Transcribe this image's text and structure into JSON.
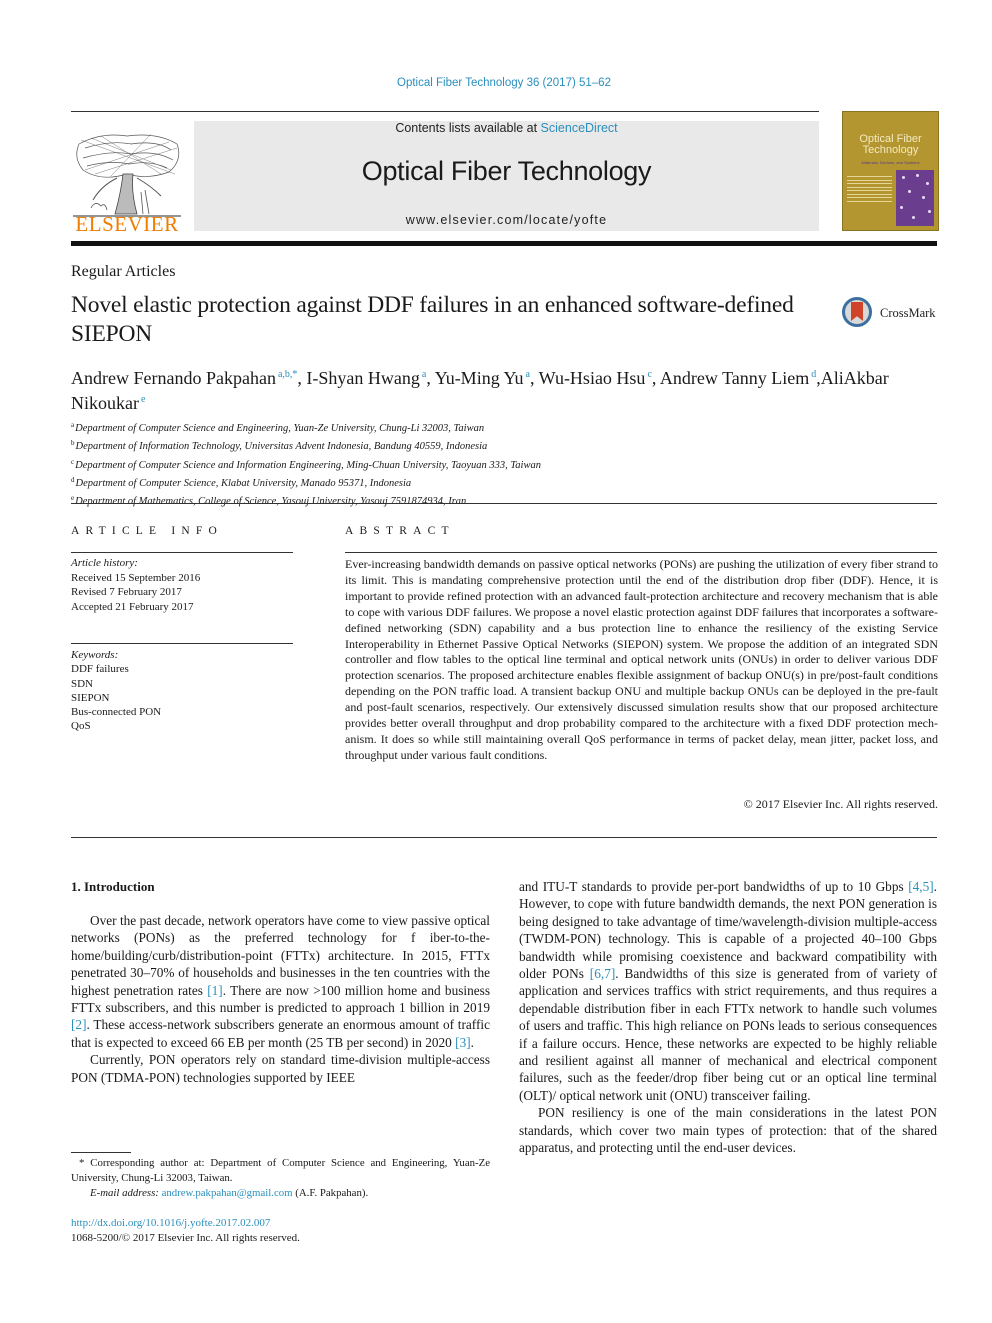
{
  "header": {
    "journal_reference": "Optical Fiber Technology 36 (2017) 51–62",
    "contents_prefix": "Contents lists available at ",
    "contents_link": "ScienceDirect",
    "journal_title": "Optical Fiber Technology",
    "journal_url": "www.elsevier.com/locate/yofte",
    "publisher_wordmark": "ELSEVIER",
    "cover": {
      "title_line1": "Optical Fiber",
      "title_line2": "Technology",
      "subtitle": "Materials, Devices, and Systems"
    },
    "colors": {
      "link": "#2a8fbd",
      "elsevier_orange": "#f07c00",
      "banner_bg": "#e9e9e9"
    }
  },
  "article": {
    "section": "Regular Articles",
    "title": "Novel elastic protection against DDF failures in an enhanced software-defined SIEPON",
    "crossmark_label": "CrossMark",
    "authors": [
      {
        "name": "Andrew Fernando Pakpahan",
        "marks": "a,b,*",
        "sep": ", "
      },
      {
        "name": "I-Shyan Hwang",
        "marks": "a",
        "sep": ", "
      },
      {
        "name": "Yu-Ming Yu",
        "marks": "a",
        "sep": ", "
      },
      {
        "name": "Wu-Hsiao Hsu",
        "marks": "c",
        "sep": ", "
      },
      {
        "name": "Andrew Tanny Liem",
        "marks": "d",
        "sep": ","
      },
      {
        "name": "AliAkbar Nikoukar",
        "marks": "e",
        "sep": ""
      }
    ],
    "affiliations": [
      {
        "key": "a",
        "text": "Department of Computer Science and Engineering, Yuan-Ze University, Chung-Li 32003, Taiwan"
      },
      {
        "key": "b",
        "text": "Department of Information Technology, Universitas Advent Indonesia, Bandung 40559, Indonesia"
      },
      {
        "key": "c",
        "text": "Department of Computer Science and Information Engineering, Ming-Chuan University, Taoyuan 333, Taiwan"
      },
      {
        "key": "d",
        "text": "Department of Computer Science, Klabat University, Manado 95371, Indonesia"
      },
      {
        "key": "e",
        "text": "Department of Mathematics, College of Science, Yasouj University, Yasouj 7591874934, Iran"
      }
    ]
  },
  "article_info": {
    "heading": "ARTICLE INFO",
    "history_label": "Article history:",
    "history": [
      "Received 15 September 2016",
      "Revised 7 February 2017",
      "Accepted 21 February 2017"
    ],
    "keywords_label": "Keywords:",
    "keywords": [
      "DDF failures",
      "SDN",
      "SIEPON",
      "Bus-connected PON",
      "QoS"
    ]
  },
  "abstract": {
    "heading": "ABSTRACT",
    "text": "Ever-increasing bandwidth demands on passive optical networks (PONs) are pushing the utilization of every fiber strand to its limit. This is mandating comprehensive protection until the end of the distribu­tion drop fiber (DDF). Hence, it is important to provide refined protection with an advanced fault-protection architecture and recovery mechanism that is able to cope with various DDF failures. We pro­pose a novel elastic protection against DDF failures that incorporates a software-defined networking (SDN) capability and a bus protection line to enhance the resiliency of the existing Service Interoperability in Ethernet Passive Optical Networks (SIEPON) system. We propose the addition of an integrated SDN controller and flow tables to the optical line terminal and optical network units (ONUs) in order to deliver various DDF protection scenarios. The proposed architecture enables flexible assignment of backup ONU(s) in pre/post-fault conditions depending on the PON traffic load. A transient backup ONU and multiple backup ONUs can be deployed in the pre-fault and post-fault scenarios, respec­tively. Our extensively discussed simulation results show that our proposed architecture provides better overall throughput and drop probability compared to the architecture with a fixed DDF protection mech­anism. It does so while still maintaining overall QoS performance in terms of packet delay, mean jitter, packet loss, and throughput under various fault conditions.",
    "copyright": "© 2017 Elsevier Inc. All rights reserved."
  },
  "body": {
    "section_heading": "1. Introduction",
    "left_paragraphs": [
      [
        {
          "t": "Over the past decade, network operators have come to view passive optical networks (PONs) as the preferred technology for f iber-to-the-home/building/curb/distribution-point (FTTx) archi­tecture. In 2015, FTTx penetrated 30–70% of households and busi­nesses in the ten countries with the highest penetration rates "
        },
        {
          "t": "[1]",
          "link": true
        },
        {
          "t": ". There are now >100 million home and business FTTx subscribers, and this number is predicted to approach 1 billion in 2019 "
        },
        {
          "t": "[2]",
          "link": true
        },
        {
          "t": ". These access-network subscribers generate an enormous amount of traffic that is expected to exceed 66 EB per month (25 TB per second) in 2020 "
        },
        {
          "t": "[3]",
          "link": true
        },
        {
          "t": "."
        }
      ],
      [
        {
          "t": "Currently, PON operators rely on standard time-division multiple-access PON (TDMA-PON) technologies supported by IEEE"
        }
      ]
    ],
    "right_paragraphs": [
      [
        {
          "t": "and ITU-T standards to provide per-port bandwidths of up to 10 Gbps "
        },
        {
          "t": "[4,5]",
          "link": true
        },
        {
          "t": ". However, to cope with future bandwidth demands, the next PON generation is being designed to take advantage of time/wavelength-division multiple-access (TWDM-PON) technol­ogy. This is capable of a projected 40–100 Gbps bandwidth while promising coexistence and backward compatibility with older PONs "
        },
        {
          "t": "[6,7]",
          "link": true
        },
        {
          "t": ". Bandwidths of this size is generated from of variety of application and services traffics with strict requirements, and thus requires a dependable distribution fiber in each FTTx network to handle such volumes of users and traffic. This high reliance on PONs leads to serious consequences if a failure occurs. Hence, these networks are expected to be highly reliable and resilient against all manner of mechanical and electrical component failures, such as the feeder/drop fiber being cut or an optical line terminal (OLT)/ optical network unit (ONU) transceiver failing."
        }
      ],
      [
        {
          "t": "PON resiliency is one of the main considerations in the latest PON standards, which cover two main types of protection: that of the shared apparatus, and protecting until the end-user devices."
        }
      ]
    ]
  },
  "footnotes": {
    "corresponding": "* Corresponding author at: Department of Computer Science and Engineering, Yuan-Ze University, Chung-Li 32003, Taiwan.",
    "email_label": "E-mail address: ",
    "email": "andrew.pakpahan@gmail.com",
    "email_suffix": " (A.F. Pakpahan).",
    "doi": "http://dx.doi.org/10.1016/j.yofte.2017.02.007",
    "issn_line": "1068-5200/© 2017 Elsevier Inc. All rights reserved."
  }
}
